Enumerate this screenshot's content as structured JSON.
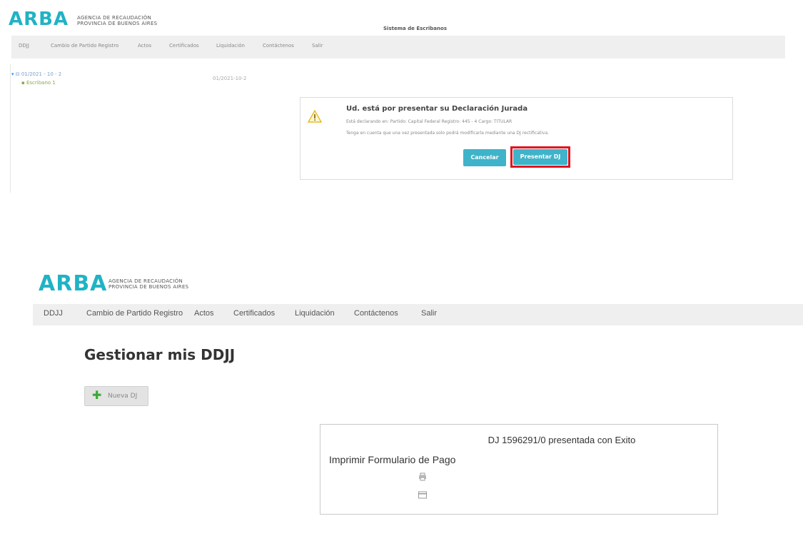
{
  "top": {
    "logo": "ARBA",
    "logo_sub_1": "AGENCIA DE RECAUDACIÓN",
    "logo_sub_2": "PROVINCIA DE BUENOS AIRES",
    "system_title": "Sistema de Escribanos",
    "nav": [
      "DDJJ",
      "Cambio de Partido Registro",
      "Actos",
      "Certificados",
      "Liquidación",
      "Contáctenos",
      "Salir"
    ],
    "tree_root": "⊟ 01/2021 - 10 - 2",
    "tree_child": "Escribano 1",
    "tree_side": "01/2021-10-2",
    "dialog": {
      "title": "Ud. está por presentar su Declaración Jurada",
      "line1": "Está declarando en: Partido: Capital Federal Registro: 445 - 4 Cargo: TITULAR",
      "line2": "Tenga en cuenta que una vez presentada solo podrá modificarla mediante una DJ rectificativa.",
      "cancel": "Cancelar",
      "submit": "Presentar DJ"
    }
  },
  "bottom": {
    "logo": "ARBA",
    "logo_sub_1": "AGENCIA DE RECAUDACIÓN",
    "logo_sub_2": "PROVINCIA DE BUENOS AIRES",
    "nav": [
      "DDJJ",
      "Cambio de Partido Registro",
      "Actos",
      "Certificados",
      "Liquidación",
      "Contáctenos",
      "Salir"
    ],
    "heading": "Gestionar mis DDJJ",
    "new_dj": "Nueva DJ",
    "result_title": "DJ 1596291/0 presentada con Exito",
    "print_label": "Imprimir Formulario de Pago"
  },
  "colors": {
    "brand": "#20b3c4",
    "highlight": "#e0141e",
    "button": "#3fb3c9"
  }
}
